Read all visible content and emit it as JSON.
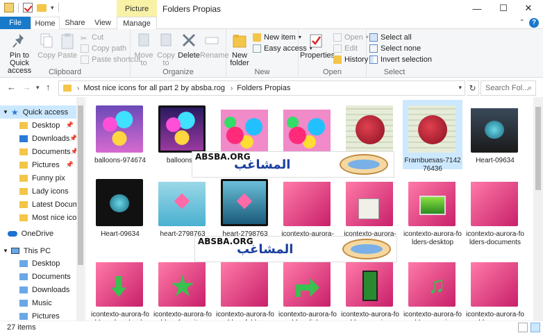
{
  "window": {
    "title": "Folders Propias",
    "contextual_tab_header": "Picture Tools",
    "controls": [
      "minimize",
      "maximize",
      "close"
    ]
  },
  "ribbon_tabs": [
    {
      "label": "File",
      "active": false
    },
    {
      "label": "Home",
      "active": true
    },
    {
      "label": "Share",
      "active": false
    },
    {
      "label": "View",
      "active": false
    },
    {
      "label": "Manage",
      "active": false
    }
  ],
  "ribbon": {
    "clipboard": {
      "label": "Clipboard",
      "pin_label": "Pin to Quick access",
      "copy_label": "Copy",
      "paste_label": "Paste",
      "cut_label": "Cut",
      "copy_path_label": "Copy path",
      "paste_shortcut_label": "Paste shortcut"
    },
    "organize": {
      "label": "Organize",
      "move_to_label": "Move to",
      "copy_to_label": "Copy to",
      "delete_label": "Delete",
      "rename_label": "Rename"
    },
    "new": {
      "label": "New",
      "new_folder_label": "New folder",
      "new_item_label": "New item",
      "easy_access_label": "Easy access"
    },
    "open": {
      "label": "Open",
      "properties_label": "Properties",
      "open_label": "Open",
      "edit_label": "Edit",
      "history_label": "History"
    },
    "select": {
      "label": "Select",
      "select_all_label": "Select all",
      "select_none_label": "Select none",
      "invert_selection_label": "Invert selection"
    }
  },
  "address": {
    "crumbs": [
      "Most nice icons for all part 2 by absba.rog",
      "Folders Propias"
    ],
    "search_placeholder": "Search Fol..."
  },
  "nav_pane": {
    "quick_access": "Quick access",
    "quick_items": [
      {
        "label": "Desktop",
        "pinned": true
      },
      {
        "label": "Downloads",
        "pinned": true
      },
      {
        "label": "Documents",
        "pinned": true
      },
      {
        "label": "Pictures",
        "pinned": true
      },
      {
        "label": "Funny pix",
        "pinned": false
      },
      {
        "label": "Lady icons",
        "pinned": false
      },
      {
        "label": "Latest Documents",
        "pinned": false
      },
      {
        "label": "Most nice icons f",
        "pinned": false
      }
    ],
    "onedrive": "OneDrive",
    "this_pc": "This PC",
    "pc_items": [
      "Desktop",
      "Documents",
      "Downloads",
      "Music",
      "Pictures"
    ]
  },
  "files": [
    {
      "name": "balloons-974674",
      "kind": "balloons"
    },
    {
      "name": "balloons-9",
      "kind": "balloons-dark"
    },
    {
      "name": "",
      "kind": "fluffy"
    },
    {
      "name": "",
      "kind": "fluffy"
    },
    {
      "name": "2",
      "kind": "berries"
    },
    {
      "name": "Frambuesas-7142 76436",
      "kind": "berries"
    },
    {
      "name": "Heart-09634",
      "kind": "heart-stone"
    },
    {
      "name": "Heart-09634",
      "kind": "heart-stone-dark"
    },
    {
      "name": "heart-2798763",
      "kind": "heart-pink"
    },
    {
      "name": "heart-2798763",
      "kind": "heart-pink-dark"
    },
    {
      "name": "icontexto-aurora-",
      "kind": "aurora"
    },
    {
      "name": "icontexto-aurora-",
      "kind": "aurora-docs"
    },
    {
      "name": "icontexto-aurora-folders-desktop",
      "kind": "aurora-desktop"
    },
    {
      "name": "icontexto-aurora-folders-documents",
      "kind": "aurora"
    },
    {
      "name": "icontexto-aurora-folders-downloads",
      "kind": "aurora-down"
    },
    {
      "name": "icontexto-aurora-folders-favorites",
      "kind": "aurora-star"
    },
    {
      "name": "icontexto-aurora-folders-folder",
      "kind": "aurora"
    },
    {
      "name": "icontexto-aurora-folders-links",
      "kind": "aurora-link"
    },
    {
      "name": "icontexto-aurora-folders-movies",
      "kind": "aurora-film"
    },
    {
      "name": "icontexto-aurora-folders-music",
      "kind": "aurora-music"
    },
    {
      "name": "icontexto-aurora-folders-open",
      "kind": "aurora"
    }
  ],
  "selected_file_index": 5,
  "watermark": {
    "en": "ABSBA.ORG",
    "ar": "المشاغب"
  },
  "status": {
    "count": "27 items"
  }
}
